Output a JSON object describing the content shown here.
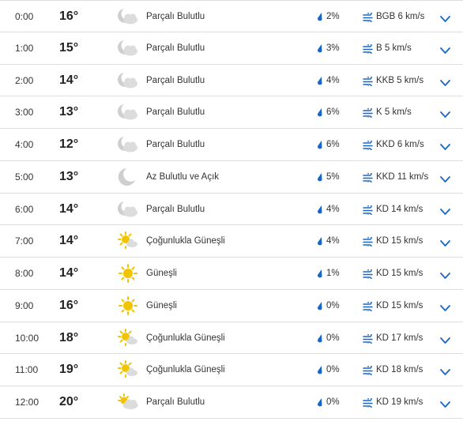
{
  "colors": {
    "accent": "#1a66c7",
    "moon": "#c8c8c8",
    "cloud": "#d4d4d4",
    "sun": "#f2c400",
    "divider": "#dddddd"
  },
  "rows": [
    {
      "time": "0:00",
      "temp": "16°",
      "icon": "moon-cloud-icon",
      "condition": "Parçalı Bulutlu",
      "precip": "2%",
      "wind": "BGB 6 km/s"
    },
    {
      "time": "1:00",
      "temp": "15°",
      "icon": "moon-cloud-icon",
      "condition": "Parçalı Bulutlu",
      "precip": "3%",
      "wind": "B 5 km/s"
    },
    {
      "time": "2:00",
      "temp": "14°",
      "icon": "moon-cloud-icon",
      "condition": "Parçalı Bulutlu",
      "precip": "4%",
      "wind": "KKB 5 km/s"
    },
    {
      "time": "3:00",
      "temp": "13°",
      "icon": "moon-cloud-icon",
      "condition": "Parçalı Bulutlu",
      "precip": "6%",
      "wind": "K 5 km/s"
    },
    {
      "time": "4:00",
      "temp": "12°",
      "icon": "moon-cloud-icon",
      "condition": "Parçalı Bulutlu",
      "precip": "6%",
      "wind": "KKD 6 km/s"
    },
    {
      "time": "5:00",
      "temp": "13°",
      "icon": "moon-icon",
      "condition": "Az Bulutlu ve Açık",
      "precip": "5%",
      "wind": "KKD 11 km/s"
    },
    {
      "time": "6:00",
      "temp": "14°",
      "icon": "moon-cloud-icon",
      "condition": "Parçalı Bulutlu",
      "precip": "4%",
      "wind": "KD 14 km/s"
    },
    {
      "time": "7:00",
      "temp": "14°",
      "icon": "sun-cloud-icon",
      "condition": "Çoğunlukla Güneşli",
      "precip": "4%",
      "wind": "KD 15 km/s"
    },
    {
      "time": "8:00",
      "temp": "14°",
      "icon": "sun-icon",
      "condition": "Güneşli",
      "precip": "1%",
      "wind": "KD 15 km/s"
    },
    {
      "time": "9:00",
      "temp": "16°",
      "icon": "sun-icon",
      "condition": "Güneşli",
      "precip": "0%",
      "wind": "KD 15 km/s"
    },
    {
      "time": "10:00",
      "temp": "18°",
      "icon": "sun-cloud-icon",
      "condition": "Çoğunlukla Güneşli",
      "precip": "0%",
      "wind": "KD 17 km/s"
    },
    {
      "time": "11:00",
      "temp": "19°",
      "icon": "sun-cloud-icon",
      "condition": "Çoğunlukla Güneşli",
      "precip": "0%",
      "wind": "KD 18 km/s"
    },
    {
      "time": "12:00",
      "temp": "20°",
      "icon": "partly-sunny-icon",
      "condition": "Parçalı Bulutlu",
      "precip": "0%",
      "wind": "KD 19 km/s"
    }
  ]
}
